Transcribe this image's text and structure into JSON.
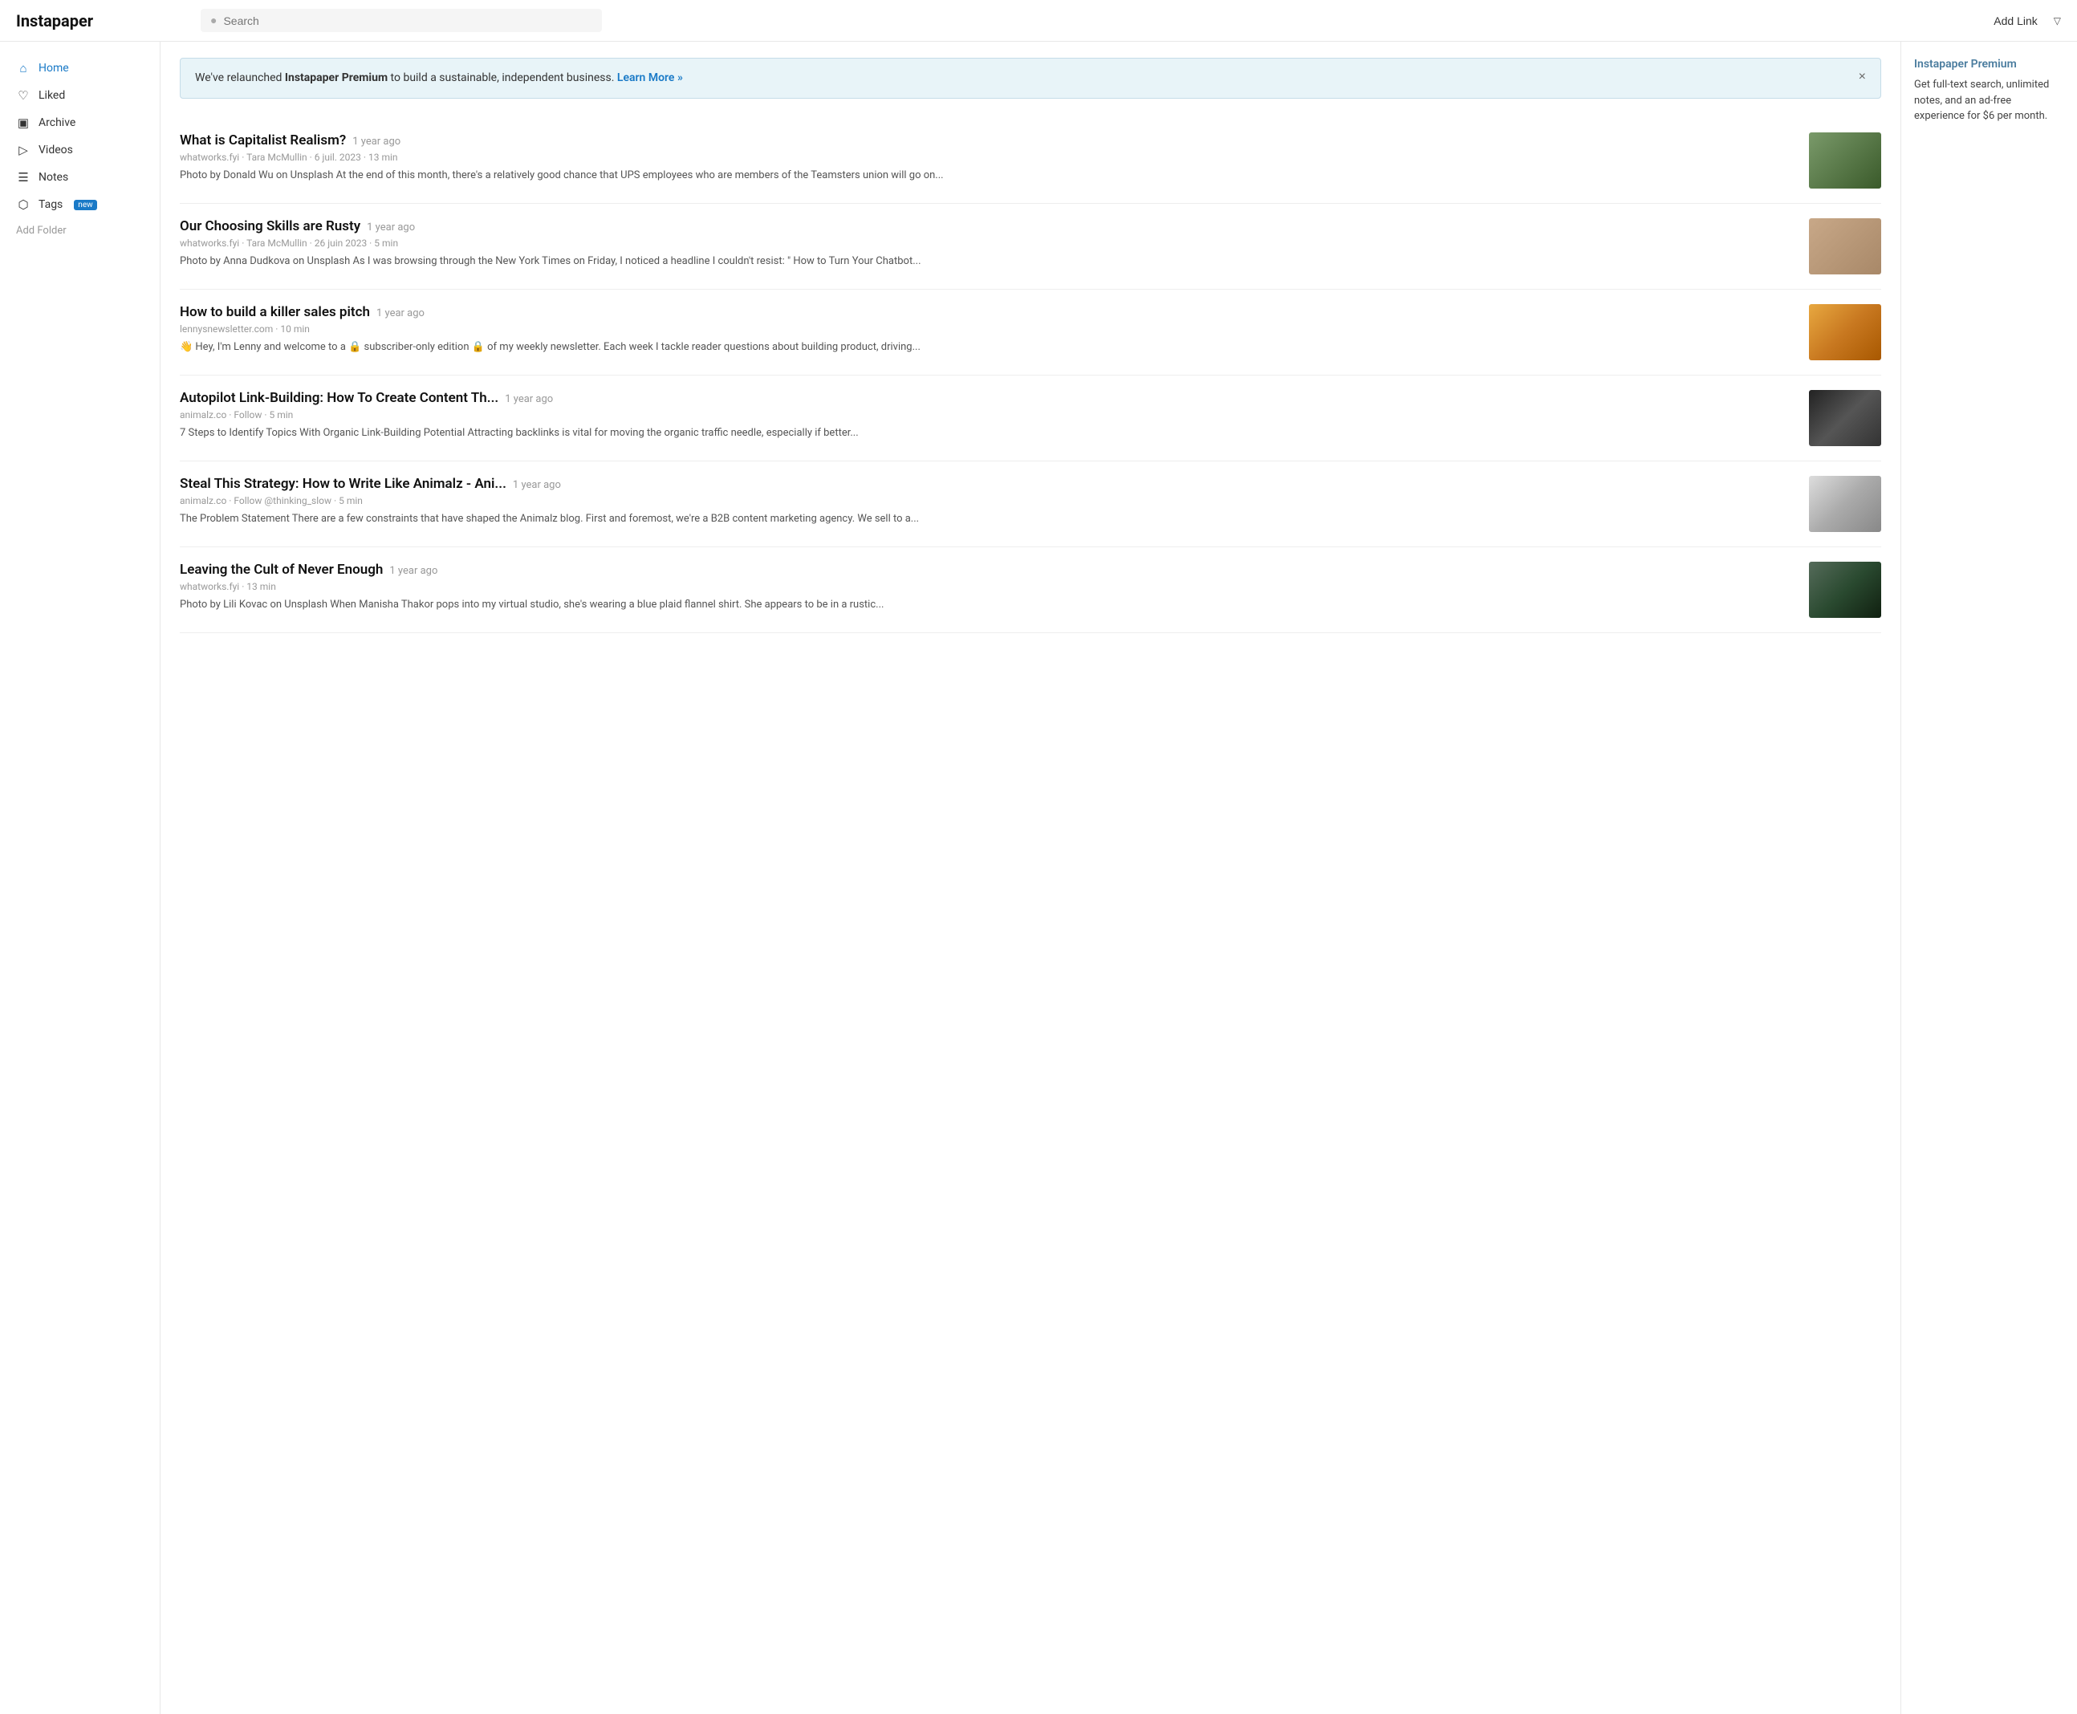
{
  "logo": "Instapaper",
  "search": {
    "placeholder": "Search"
  },
  "topbar": {
    "add_link": "Add Link"
  },
  "sidebar": {
    "items": [
      {
        "id": "home",
        "label": "Home",
        "icon": "🏠",
        "active": true
      },
      {
        "id": "liked",
        "label": "Liked",
        "icon": "♡",
        "active": false
      },
      {
        "id": "archive",
        "label": "Archive",
        "icon": "⊟",
        "active": false
      },
      {
        "id": "videos",
        "label": "Videos",
        "icon": "▷",
        "active": false
      },
      {
        "id": "notes",
        "label": "Notes",
        "icon": "☰",
        "active": false
      },
      {
        "id": "tags",
        "label": "Tags",
        "icon": "🏷",
        "active": false,
        "badge": "new"
      }
    ],
    "add_folder": "Add Folder"
  },
  "banner": {
    "text_before": "We've relaunched ",
    "brand": "Instapaper Premium",
    "text_after": " to build a sustainable, independent business. ",
    "link": "Learn More »"
  },
  "premium": {
    "title": "Instapaper Premium",
    "description": "Get full-text search, unlimited notes, and an ad-free experience for $6 per month."
  },
  "articles": [
    {
      "title": "What is Capitalist Realism?",
      "time_ago": "1 year ago",
      "source": "whatworks.fyi · Tara McMullin",
      "date": "6 juil. 2023",
      "read_time": "13 min",
      "excerpt": "Photo by Donald Wu on Unsplash At the end of this month, there's a relatively good chance that UPS employees who are members of the Teamsters union will go on...",
      "thumb_class": "thumb-1"
    },
    {
      "title": "Our Choosing Skills are Rusty",
      "time_ago": "1 year ago",
      "source": "whatworks.fyi · Tara McMullin",
      "date": "26 juin 2023",
      "read_time": "5 min",
      "excerpt": "Photo by Anna Dudkova on Unsplash As I was browsing through the New York Times on Friday, I noticed a headline I couldn't resist: \" How to Turn Your Chatbot...",
      "thumb_class": "thumb-2"
    },
    {
      "title": "How to build a killer sales pitch",
      "time_ago": "1 year ago",
      "source": "lennysnewsletter.com",
      "date": "",
      "read_time": "10 min",
      "excerpt": "👋 Hey, I'm Lenny and welcome to a 🔒 subscriber-only edition 🔒 of my weekly newsletter. Each week I tackle reader questions about building product, driving...",
      "thumb_class": "thumb-3"
    },
    {
      "title": "Autopilot Link-Building: How To Create Content Th...",
      "time_ago": "1 year ago",
      "source": "animalz.co · Follow",
      "date": "",
      "read_time": "5 min",
      "excerpt": "7 Steps to Identify Topics With Organic Link-Building Potential Attracting backlinks is vital for moving the organic traffic needle, especially if better...",
      "thumb_class": "thumb-4"
    },
    {
      "title": "Steal This Strategy: How to Write Like Animalz - Ani...",
      "time_ago": "1 year ago",
      "source": "animalz.co · Follow @thinking_slow",
      "date": "",
      "read_time": "5 min",
      "excerpt": "The Problem Statement There are a few constraints that have shaped the Animalz blog. First and foremost, we're a B2B content marketing agency. We sell to a...",
      "thumb_class": "thumb-5"
    },
    {
      "title": "Leaving the Cult of Never Enough",
      "time_ago": "1 year ago",
      "source": "whatworks.fyi",
      "date": "",
      "read_time": "13 min",
      "excerpt": "Photo by Lili Kovac on Unsplash When Manisha Thakor pops into my virtual studio, she's wearing a blue plaid flannel shirt. She appears to be in a rustic...",
      "thumb_class": "thumb-6"
    }
  ]
}
